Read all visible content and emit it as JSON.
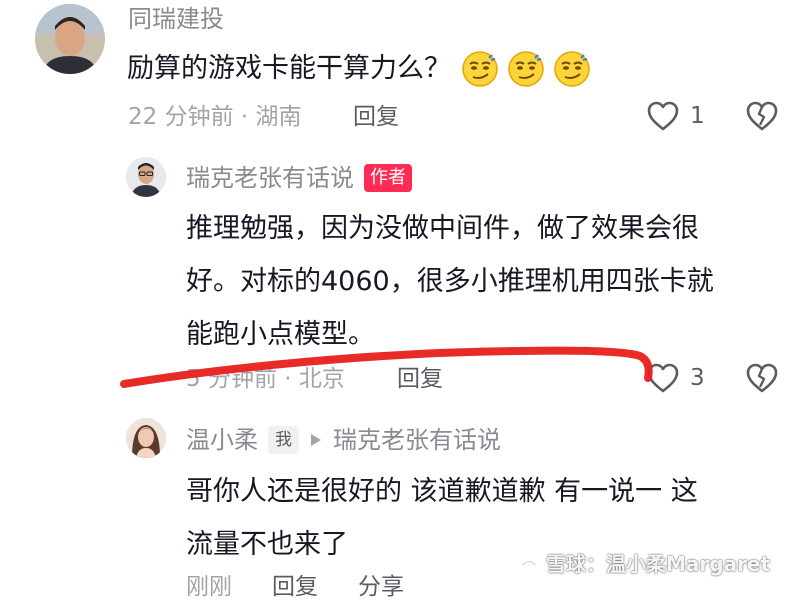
{
  "colors": {
    "author_badge": "#fe2c55",
    "annotation_stroke": "#e8201c",
    "meta_gray": "#a3a4a8",
    "username_gray": "#8a8b91"
  },
  "comment1": {
    "username": "同瑞建投",
    "text": "励算的游戏卡能干算力么？",
    "emojis": [
      "smirk-face-icon",
      "smirk-face-icon",
      "smirk-face-icon"
    ],
    "meta": "22 分钟前 · 湖南",
    "reply_label": "回复",
    "like_count": "1"
  },
  "reply1": {
    "username": "瑞克老张有话说",
    "badge": "作者",
    "text_lines": [
      "推理勉强，因为没做中间件，做了效果会很",
      "好。对标的4060，很多小推理机用四张卡就",
      "能跑小点模型。"
    ],
    "meta": "5 分钟前 · 北京",
    "reply_label": "回复",
    "like_count": "3"
  },
  "reply2": {
    "username": "温小柔",
    "badge": "我",
    "reply_target": "瑞克老张有话说",
    "text_lines": [
      "哥你人还是很好的 该道歉道歉 有一说一 这",
      "流量不也来了"
    ],
    "meta": "刚刚",
    "reply_label": "回复",
    "share_label": "分享"
  },
  "watermark": {
    "text": "雪球：温小柔Margaret"
  }
}
